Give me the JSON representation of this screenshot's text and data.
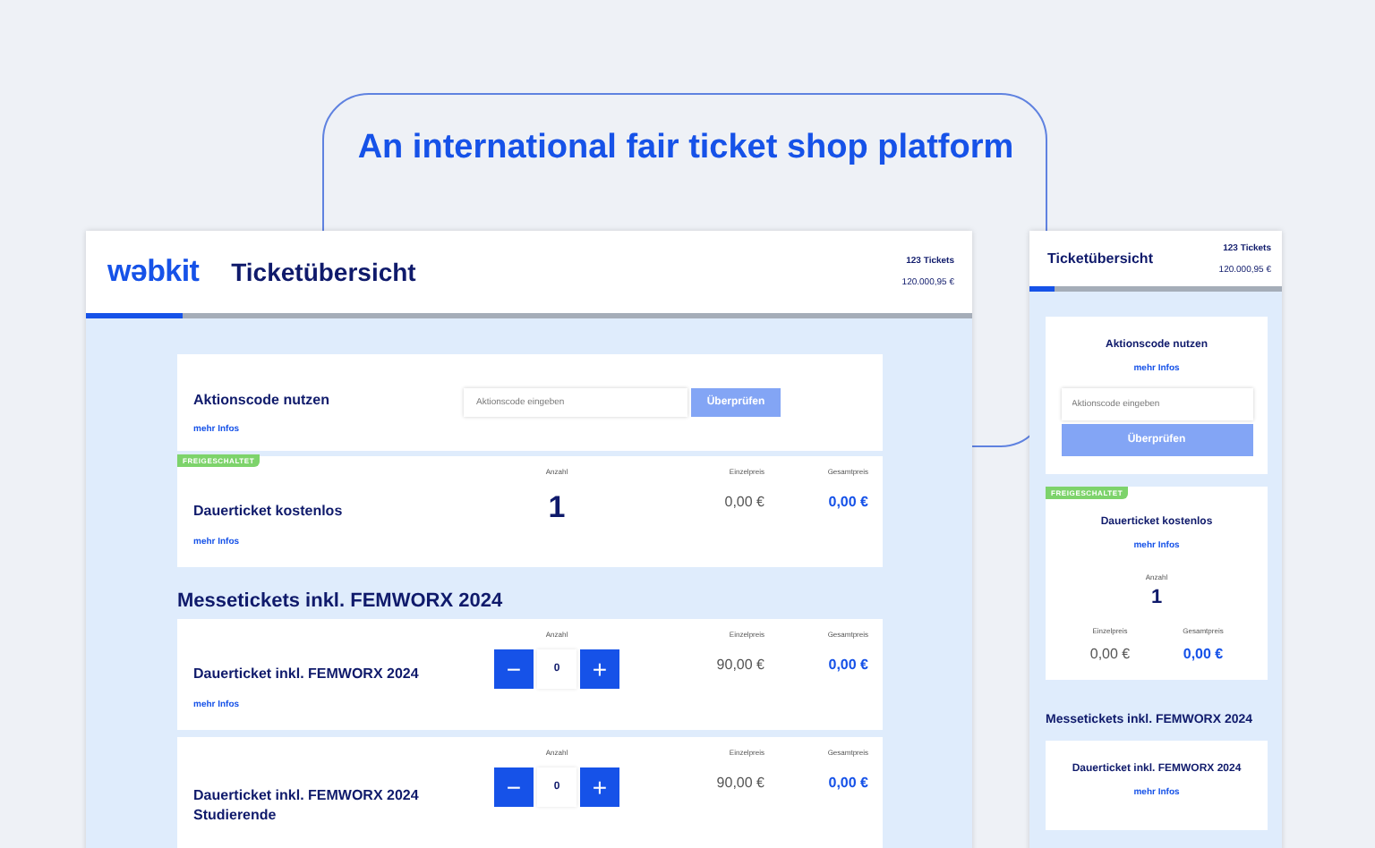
{
  "headline": "An international fair ticket shop platform",
  "desktop": {
    "logo": "wəbkit",
    "title": "Ticketübersicht",
    "ticket_count": "123 Tickets",
    "total": "120.000,95 €",
    "progress": {
      "level": 0.11
    },
    "promo": {
      "title": "Aktionscode nutzen",
      "link": "mehr Infos",
      "placeholder": "Aktionscode eingeben",
      "button": "Überprüfen"
    },
    "free_ticket": {
      "badge": "FREIGESCHALTET",
      "name": "Dauerticket kostenlos",
      "link": "mehr Infos",
      "quantity_label": "Anzahl",
      "unit_price_label": "Einzelpreis",
      "total_price_label": "Gesamtpreis",
      "quantity": "1",
      "unit_price": "0,00 €",
      "total_price": "0,00 €"
    },
    "section_title": "Messetickets inkl. FEMWORX 2024",
    "tickets": [
      {
        "name": "Dauerticket inkl. FEMWORX 2024",
        "link": "mehr Infos",
        "quantity_label": "Anzahl",
        "unit_price_label": "Einzelpreis",
        "total_price_label": "Gesamtpreis",
        "minus": "−",
        "quantity": "0",
        "plus": "+",
        "unit_price": "90,00 €",
        "total_price": "0,00 €"
      },
      {
        "name": "Dauerticket inkl. FEMWORX 2024 Studierende",
        "quantity_label": "Anzahl",
        "unit_price_label": "Einzelpreis",
        "total_price_label": "Gesamtpreis",
        "minus": "−",
        "quantity": "0",
        "plus": "+",
        "unit_price": "90,00 €",
        "total_price": "0,00 €"
      }
    ]
  },
  "mobile": {
    "title": "Ticketübersicht",
    "ticket_count": "123 Tickets",
    "total": "120.000,95 €",
    "progress": {
      "level": 0.1
    },
    "promo": {
      "title": "Aktionscode nutzen",
      "link": "mehr Infos",
      "placeholder": "Aktionscode eingeben",
      "button": "Überprüfen"
    },
    "free_ticket": {
      "badge": "FREIGESCHALTET",
      "name": "Dauerticket kostenlos",
      "link": "mehr Infos",
      "quantity_label": "Anzahl",
      "quantity": "1",
      "unit_price_label": "Einzelpreis",
      "unit_price": "0,00 €",
      "total_price_label": "Gesamtpreis",
      "total_price": "0,00 €"
    },
    "section_title": "Messetickets inkl. FEMWORX 2024",
    "tickets": [
      {
        "name": "Dauerticket inkl. FEMWORX 2024",
        "link": "mehr Infos"
      }
    ]
  }
}
